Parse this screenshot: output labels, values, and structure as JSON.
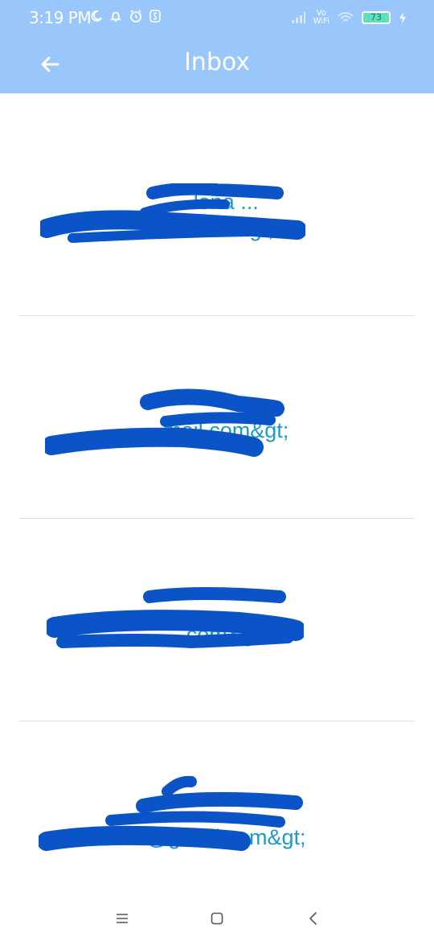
{
  "status_bar": {
    "time": "3:19 PM",
    "left_icons": [
      "moon-icon",
      "bell-icon",
      "alarm-icon",
      "s-icon"
    ],
    "right_icons": [
      "signal-icon",
      "vowifi-icon",
      "wifi-icon",
      "battery-icon",
      "charging-icon"
    ],
    "vowifi_top": "Vo",
    "vowifi_bottom": "WiFi",
    "battery_level": "73"
  },
  "toolbar": {
    "title": "Inbox",
    "back_icon": "arrow-left-icon",
    "background": "#99c6fb"
  },
  "messages": [
    {
      "name": "...lona ...",
      "email": "...il.com&gt;"
    },
    {
      "name": "",
      "email": "...mail.com&gt;"
    },
    {
      "name": "...",
      "email": "...com&gt;"
    },
    {
      "name": "",
      "email": "...@gmail.com&gt;"
    }
  ],
  "navbar": {
    "menu_icon": "menu-icon",
    "home_icon": "square-home-icon",
    "back_icon": "chevron-left-icon"
  },
  "colors": {
    "text": "#1c9ac3",
    "redaction": "#0a54c7",
    "divider": "#dedede"
  }
}
